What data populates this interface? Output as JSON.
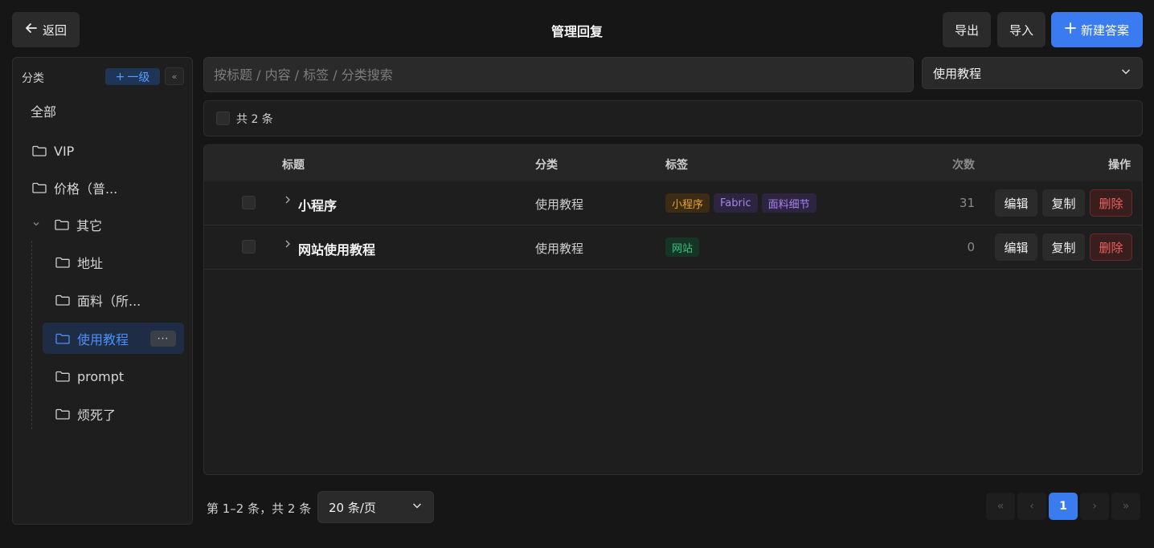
{
  "header": {
    "back_label": "返回",
    "title": "管理回复",
    "export_label": "导出",
    "import_label": "导入",
    "new_label": "新建答案"
  },
  "sidebar": {
    "heading": "分类",
    "add_label": "一级",
    "collapse_glyph": "«",
    "all_label": "全部",
    "items": [
      {
        "label": "VIP"
      },
      {
        "label": "价格（普..."
      },
      {
        "label": "其它"
      },
      {
        "label": "地址"
      },
      {
        "label": "面料（所..."
      },
      {
        "label": "使用教程"
      },
      {
        "label": "prompt"
      },
      {
        "label": "烦死了"
      }
    ],
    "more_glyph": "···"
  },
  "search": {
    "placeholder": "按标题 / 内容 / 标签 / 分类搜索",
    "value": ""
  },
  "category_filter": {
    "selected": "使用教程"
  },
  "summary": {
    "count_label": "共 2 条"
  },
  "table": {
    "columns": {
      "title": "标题",
      "category": "分类",
      "tags": "标签",
      "count": "次数",
      "actions": "操作"
    },
    "rows": [
      {
        "title": "小程序",
        "category": "使用教程",
        "tags": [
          "小程序",
          "Fabric",
          "面料细节"
        ],
        "count": "31",
        "edit": "编辑",
        "copy": "复制",
        "delete": "删除"
      },
      {
        "title": "网站使用教程",
        "category": "使用教程",
        "tags": [
          "网站"
        ],
        "count": "0",
        "edit": "编辑",
        "copy": "复制",
        "delete": "删除"
      }
    ]
  },
  "pagination": {
    "range_text": "第 1–2 条，共 2 条",
    "page_size": "20 条/页",
    "first": "«",
    "prev": "‹",
    "current": "1",
    "next": "›",
    "last": "»"
  },
  "colors": {
    "accent": "#3a7cf0",
    "tag_orange": "#e8a33d",
    "tag_purple": "#a883f2",
    "tag_green": "#3cc47c",
    "danger": "#f06060"
  }
}
